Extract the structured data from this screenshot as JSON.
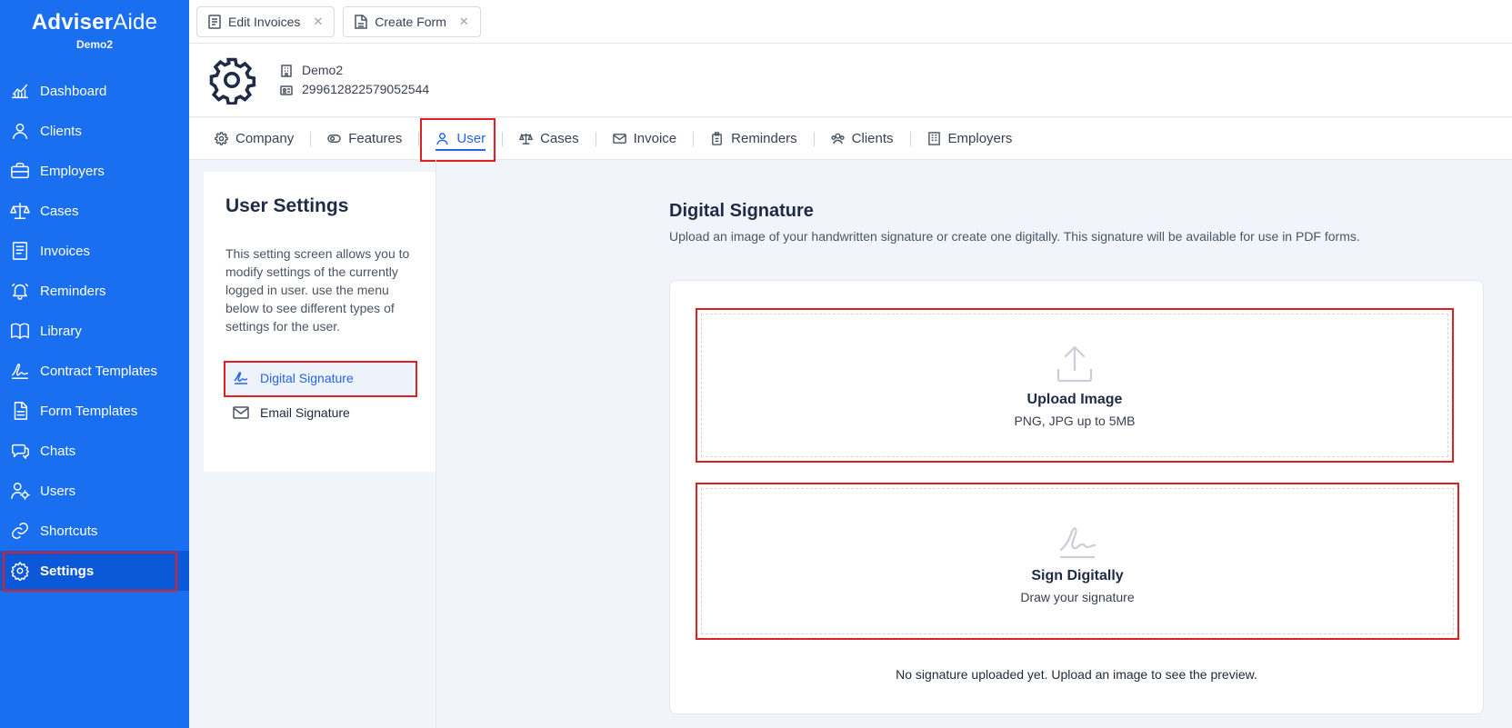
{
  "brand": {
    "name_bold": "Adviser",
    "name_light": "Aide",
    "sub": "Demo2"
  },
  "sidebar": {
    "items": [
      {
        "label": "Dashboard",
        "icon": "chart-icon"
      },
      {
        "label": "Clients",
        "icon": "user-icon"
      },
      {
        "label": "Employers",
        "icon": "briefcase-icon"
      },
      {
        "label": "Cases",
        "icon": "scale-icon"
      },
      {
        "label": "Invoices",
        "icon": "invoice-icon"
      },
      {
        "label": "Reminders",
        "icon": "bell-icon"
      },
      {
        "label": "Library",
        "icon": "book-icon"
      },
      {
        "label": "Contract Templates",
        "icon": "signature-icon"
      },
      {
        "label": "Form Templates",
        "icon": "document-icon"
      },
      {
        "label": "Chats",
        "icon": "chat-icon"
      },
      {
        "label": "Users",
        "icon": "users-gear-icon"
      },
      {
        "label": "Shortcuts",
        "icon": "link-icon"
      },
      {
        "label": "Settings",
        "icon": "gear-icon",
        "active": true
      }
    ]
  },
  "doc_tabs": [
    {
      "label": "Edit Invoices"
    },
    {
      "label": "Create Form"
    }
  ],
  "company": {
    "name": "Demo2",
    "id": "299612822579052544"
  },
  "section_tabs": [
    {
      "label": "Company"
    },
    {
      "label": "Features"
    },
    {
      "label": "User",
      "active": true
    },
    {
      "label": "Cases"
    },
    {
      "label": "Invoice"
    },
    {
      "label": "Reminders"
    },
    {
      "label": "Clients"
    },
    {
      "label": "Employers"
    }
  ],
  "user_settings": {
    "title": "User Settings",
    "description": "This setting screen allows you to modify settings of the currently logged in user. use the menu below to see different types of settings for the user.",
    "menu": [
      {
        "label": "Digital Signature",
        "active": true
      },
      {
        "label": "Email Signature"
      }
    ]
  },
  "digital_signature": {
    "title": "Digital Signature",
    "description": "Upload an image of your handwritten signature or create one digitally. This signature will be available for use in PDF forms.",
    "upload": {
      "title": "Upload Image",
      "hint": "PNG, JPG up to 5MB"
    },
    "sign": {
      "title": "Sign Digitally",
      "hint": "Draw your signature"
    },
    "empty_message": "No signature uploaded yet. Upload an image to see the preview."
  },
  "colors": {
    "sidebar": "#1a6ff0",
    "sidebar_active": "#0b58d8",
    "accent": "#2563eb",
    "highlight": "#e02020"
  }
}
